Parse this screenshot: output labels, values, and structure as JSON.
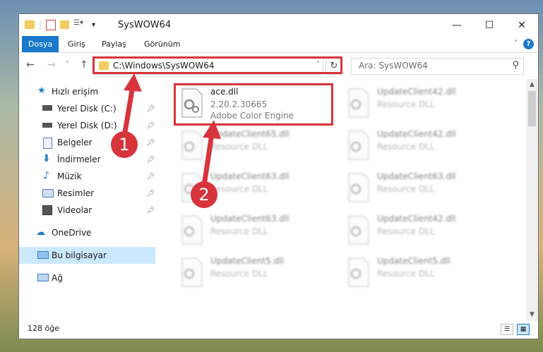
{
  "window": {
    "title": "SysWOW64",
    "controls": {
      "minimize": "—",
      "maximize": "☐",
      "close": "✕"
    }
  },
  "ribbon": {
    "tabs": [
      "Dosya",
      "Giriş",
      "Paylaş",
      "Görünüm"
    ],
    "active_tab": "Dosya",
    "help": "?"
  },
  "navigation": {
    "back": "←",
    "forward": "→",
    "recent": "˅",
    "up": "↑",
    "address": "C:\\Windows\\SysWOW64",
    "refresh": "↻",
    "search_placeholder": "Ara: SysWOW64"
  },
  "sidebar": {
    "quick_access": "Hızlı erişim",
    "items": [
      {
        "label": "Yerel Disk (C:)",
        "icon": "drive-icon",
        "pinned": true
      },
      {
        "label": "Yerel Disk (D:)",
        "icon": "drive-icon",
        "pinned": true
      },
      {
        "label": "Belgeler",
        "icon": "documents-icon",
        "pinned": true
      },
      {
        "label": "İndirmeler",
        "icon": "downloads-icon",
        "pinned": true
      },
      {
        "label": "Müzik",
        "icon": "music-icon",
        "pinned": true
      },
      {
        "label": "Resimler",
        "icon": "pictures-icon",
        "pinned": true
      },
      {
        "label": "Videolar",
        "icon": "videos-icon",
        "pinned": true
      }
    ],
    "onedrive": "OneDrive",
    "this_pc": "Bu bilgisayar",
    "network": "Ağ"
  },
  "files": [
    {
      "name": "ace.dll",
      "version": "2.20.2.30665",
      "description": "Adobe Color Engine",
      "highlighted": true
    },
    {
      "name": "UpdateClient42.dll",
      "version": "Resource DLL",
      "description": ""
    },
    {
      "name": "UpdateClient65.dll",
      "version": "Resource DLL",
      "description": ""
    },
    {
      "name": "UpdateClient42.dll",
      "version": "Resource DLL",
      "description": ""
    },
    {
      "name": "UpdateClient63.dll",
      "version": "Resource DLL",
      "description": ""
    },
    {
      "name": "UpdateClient63.dll",
      "version": "Resource DLL",
      "description": ""
    },
    {
      "name": "UpdateClient63.dll",
      "version": "Resource DLL",
      "description": ""
    },
    {
      "name": "UpdateClient42.dll",
      "version": "Resource DLL",
      "description": ""
    },
    {
      "name": "UpdateClient5.dll",
      "version": "Resource DLL",
      "description": ""
    },
    {
      "name": "UpdateClient5.dll",
      "version": "Resource DLL",
      "description": ""
    }
  ],
  "status": {
    "item_count": "128 öğe"
  },
  "callouts": [
    "1",
    "2"
  ],
  "colors": {
    "accent": "#1979ca",
    "highlight": "#d7343b",
    "selected": "#cce8ff"
  }
}
